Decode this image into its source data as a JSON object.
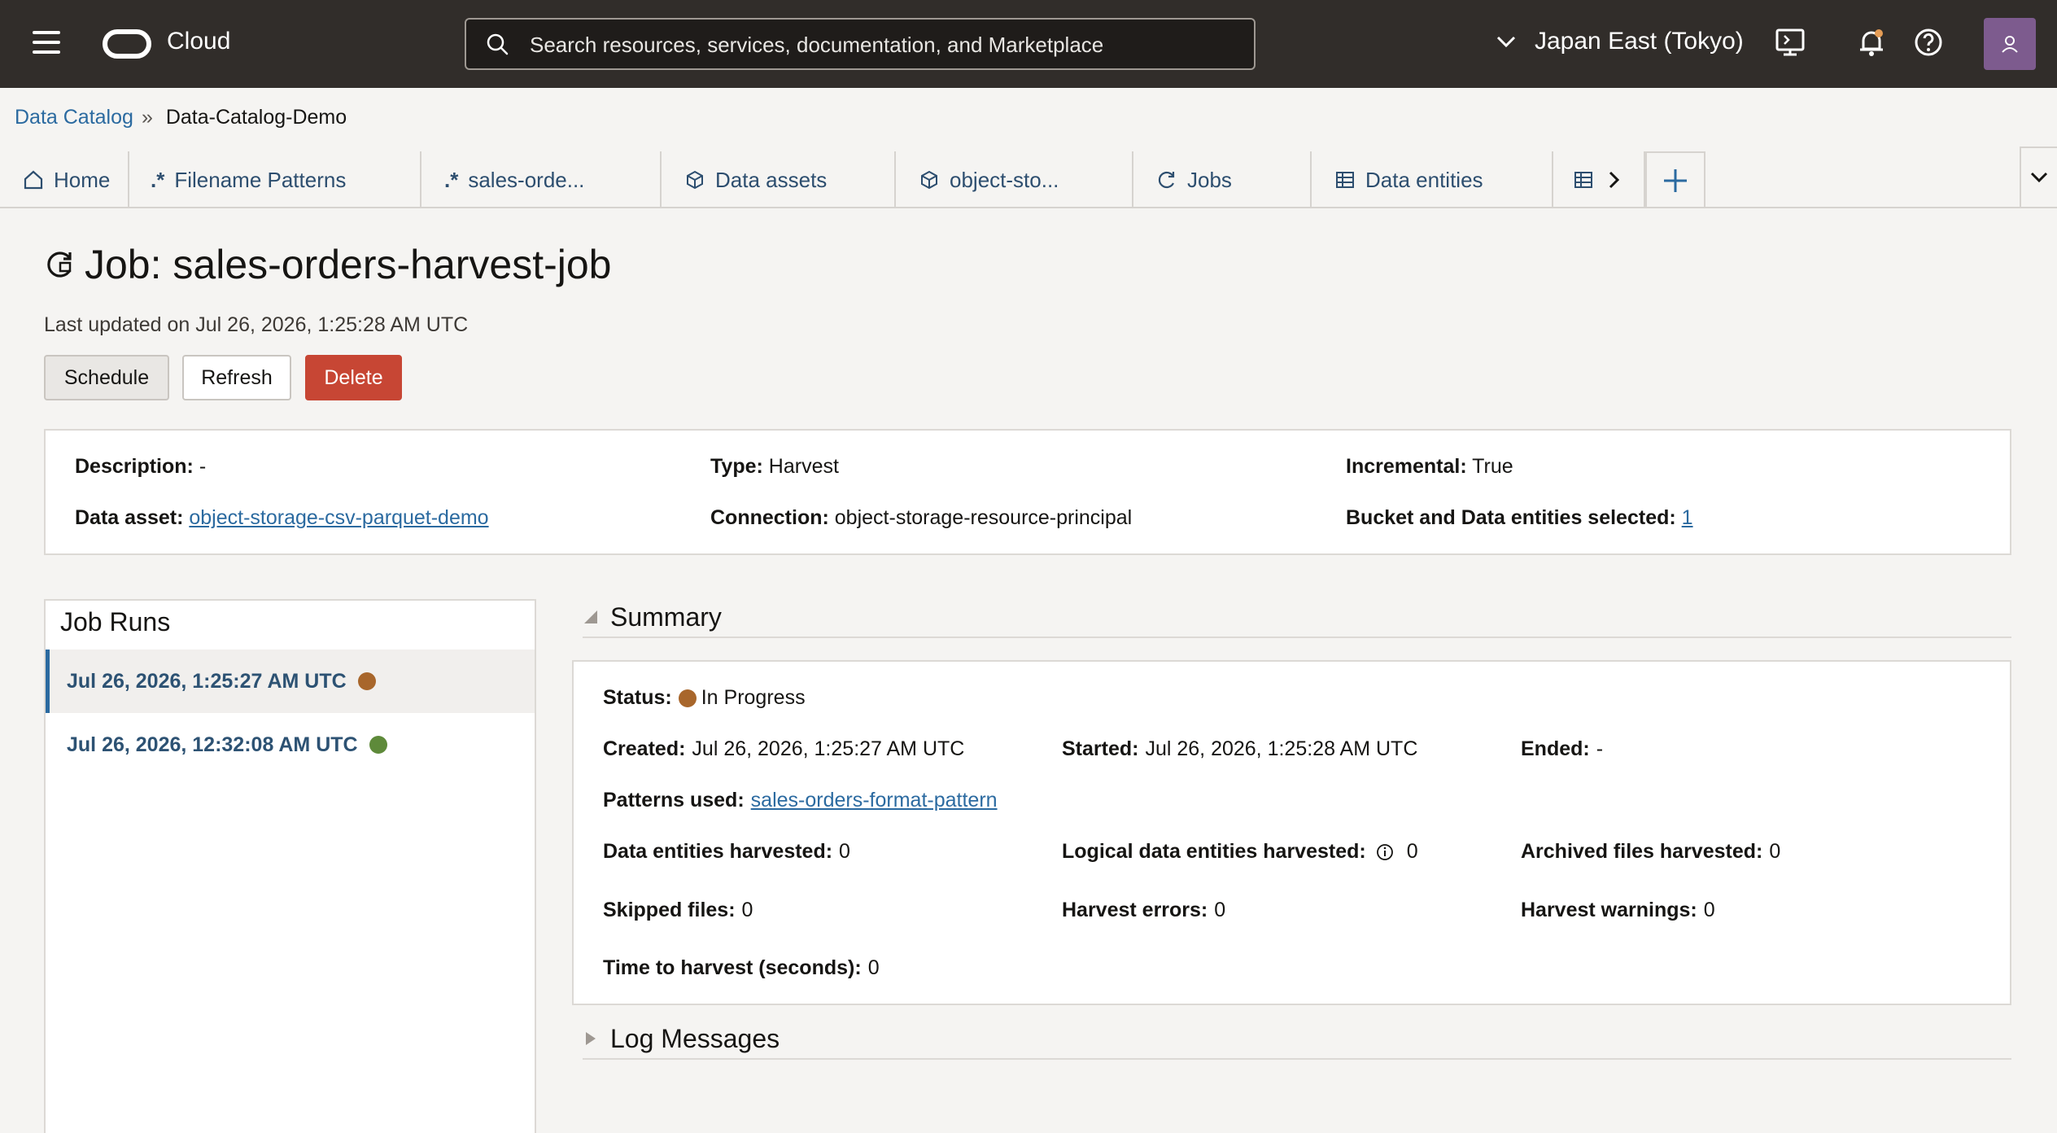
{
  "topbar": {
    "brand": "Cloud",
    "search_placeholder": "Search resources, services, documentation, and Marketplace",
    "region": "Japan East (Tokyo)"
  },
  "breadcrumb": {
    "parent": "Data Catalog",
    "separator": "»",
    "current": "Data-Catalog-Demo"
  },
  "tabs": [
    {
      "label": "Home"
    },
    {
      "label": "Filename Patterns"
    },
    {
      "label": "sales-orde..."
    },
    {
      "label": "Data assets"
    },
    {
      "label": "object-sto..."
    },
    {
      "label": "Jobs"
    },
    {
      "label": "Data entities"
    }
  ],
  "page": {
    "title": "Job: sales-orders-harvest-job",
    "last_updated": "Last updated on Jul 26, 2026, 1:25:28 AM UTC"
  },
  "actions": {
    "schedule": "Schedule",
    "refresh": "Refresh",
    "delete": "Delete"
  },
  "details": {
    "description_label": "Description:",
    "description_value": "-",
    "type_label": "Type:",
    "type_value": "Harvest",
    "incremental_label": "Incremental:",
    "incremental_value": "True",
    "data_asset_label": "Data asset:",
    "data_asset_value": "object-storage-csv-parquet-demo",
    "connection_label": "Connection:",
    "connection_value": "object-storage-resource-principal",
    "bucket_label": "Bucket and Data entities selected:",
    "bucket_value": "1"
  },
  "job_runs": {
    "title": "Job Runs",
    "items": [
      {
        "label": "Jul 26, 2026, 1:25:27 AM UTC",
        "status_color": "#a8662b"
      },
      {
        "label": "Jul 26, 2026, 12:32:08 AM UTC",
        "status_color": "#5e8a3a"
      }
    ]
  },
  "summary": {
    "title": "Summary",
    "status_label": "Status:",
    "status_value": "In Progress",
    "status_color": "#a8662b",
    "created_label": "Created:",
    "created_value": "Jul 26, 2026, 1:25:27 AM UTC",
    "started_label": "Started:",
    "started_value": "Jul 26, 2026, 1:25:28 AM UTC",
    "ended_label": "Ended:",
    "ended_value": "-",
    "patterns_label": "Patterns used:",
    "patterns_value": "sales-orders-format-pattern",
    "entities_label": "Data entities harvested:",
    "entities_value": "0",
    "logical_label": "Logical data entities harvested:",
    "logical_value": "0",
    "archived_label": "Archived files harvested:",
    "archived_value": "0",
    "skipped_label": "Skipped files:",
    "skipped_value": "0",
    "errors_label": "Harvest errors:",
    "errors_value": "0",
    "warnings_label": "Harvest warnings:",
    "warnings_value": "0",
    "time_label": "Time to harvest (seconds):",
    "time_value": "0"
  },
  "log_messages": {
    "title": "Log Messages"
  }
}
